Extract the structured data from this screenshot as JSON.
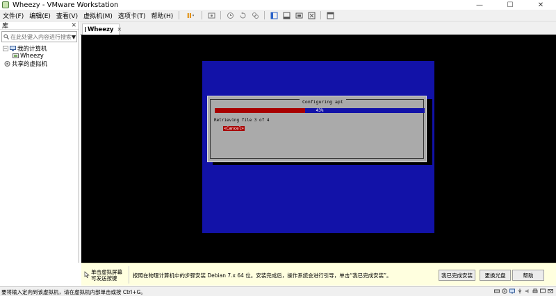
{
  "window": {
    "title": "Wheezy - VMware Workstation",
    "controls": [
      "—",
      "☐",
      "✕"
    ]
  },
  "menu": [
    "文件(F)",
    "编辑(E)",
    "查看(V)",
    "虚拟机(M)",
    "选项卡(T)",
    "帮助(H)"
  ],
  "library": {
    "title": "库",
    "close": "✕",
    "search_placeholder": "在此处键入内容进行搜索",
    "tree": {
      "my_computer": "我的计算机",
      "vm": "Wheezy",
      "shared": "共享的虚拟机"
    }
  },
  "tab": {
    "label": "Wheezy",
    "close": "✕"
  },
  "vm_screen": {
    "dialog_title": "Configuring apt",
    "progress_percent": 43,
    "progress_label": "43%",
    "status": "Retrieving file 3 of 4",
    "cancel": "<Cancel>"
  },
  "hint_bar": {
    "left_line1": "单击虚拟屏幕",
    "left_line2": "可发送按键",
    "text": "按照在物理计算机中的步骤安装 Debian 7.x 64 位。安装完成后，操作系统会进行引导，单击“我已完成安装”。",
    "btn_done": "我已完成安装",
    "btn_change_disc": "更换光盘",
    "btn_help": "帮助"
  },
  "statusbar": {
    "text": "要将输入定向到该虚拟机，请在虚拟机内部单击或按 Ctrl+G。"
  },
  "colors": {
    "vm_blue": "#1212a8",
    "dialog_gray": "#aaaaaa",
    "progress_red": "#a80000",
    "hint_yellow": "#ffffdf"
  }
}
